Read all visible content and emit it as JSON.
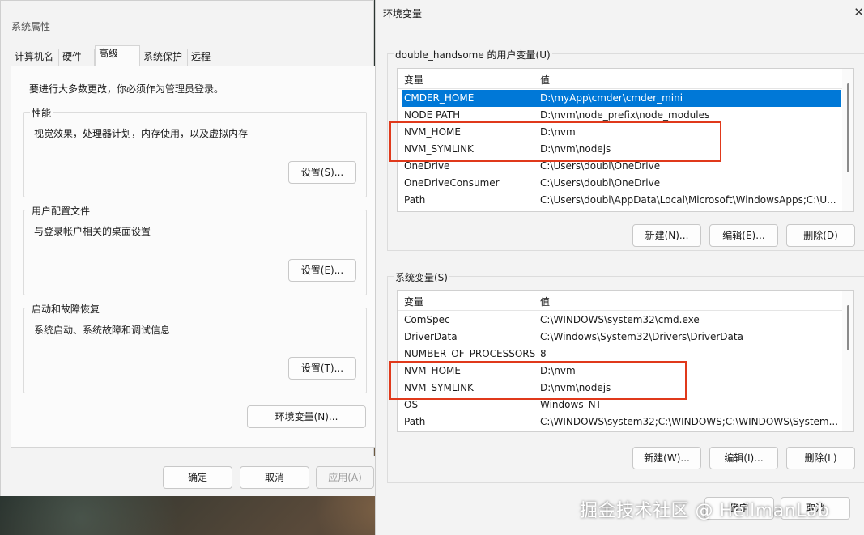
{
  "system_properties": {
    "title": "系统属性",
    "tabs": [
      "计算机名",
      "硬件",
      "高级",
      "系统保护",
      "远程"
    ],
    "admin_note": "要进行大多数更改，你必须作为管理员登录。",
    "performance": {
      "legend": "性能",
      "description": "视觉效果，处理器计划，内存使用，以及虚拟内存",
      "button": "设置(S)..."
    },
    "user_profiles": {
      "legend": "用户配置文件",
      "description": "与登录帐户相关的桌面设置",
      "button": "设置(E)..."
    },
    "startup_recovery": {
      "legend": "启动和故障恢复",
      "description": "系统启动、系统故障和调试信息",
      "button": "设置(T)..."
    },
    "env_button": "环境变量(N)...",
    "ok": "确定",
    "cancel": "取消",
    "apply": "应用(A)"
  },
  "env_vars": {
    "title": "环境变量",
    "close_glyph": "✕",
    "user_section": {
      "label": "double_handsome 的用户变量(U)",
      "col_var": "变量",
      "col_val": "值",
      "rows": [
        {
          "name": "CMDER_HOME",
          "value": "D:\\myApp\\cmder\\cmder_mini",
          "selected": true
        },
        {
          "name": "NODE PATH",
          "value": "D:\\nvm\\node_prefix\\node_modules",
          "selected": false
        },
        {
          "name": "NVM_HOME",
          "value": "D:\\nvm",
          "selected": false
        },
        {
          "name": "NVM_SYMLINK",
          "value": "D:\\nvm\\nodejs",
          "selected": false
        },
        {
          "name": "OneDrive",
          "value": "C:\\Users\\doubl\\OneDrive",
          "selected": false
        },
        {
          "name": "OneDriveConsumer",
          "value": "C:\\Users\\doubl\\OneDrive",
          "selected": false
        },
        {
          "name": "Path",
          "value": "C:\\Users\\doubl\\AppData\\Local\\Microsoft\\WindowsApps;C:\\U...",
          "selected": false
        }
      ],
      "new": "新建(N)...",
      "edit": "编辑(E)...",
      "delete": "删除(D)"
    },
    "system_section": {
      "label": "系统变量(S)",
      "col_var": "变量",
      "col_val": "值",
      "rows": [
        {
          "name": "ComSpec",
          "value": "C:\\WINDOWS\\system32\\cmd.exe",
          "selected": false
        },
        {
          "name": "DriverData",
          "value": "C:\\Windows\\System32\\Drivers\\DriverData",
          "selected": false
        },
        {
          "name": "NUMBER_OF_PROCESSORS",
          "value": "8",
          "selected": false
        },
        {
          "name": "NVM_HOME",
          "value": "D:\\nvm",
          "selected": false
        },
        {
          "name": "NVM_SYMLINK",
          "value": "D:\\nvm\\nodejs",
          "selected": false
        },
        {
          "name": "OS",
          "value": "Windows_NT",
          "selected": false
        },
        {
          "name": "Path",
          "value": "C:\\WINDOWS\\system32;C:\\WINDOWS;C:\\WINDOWS\\System...",
          "selected": false
        }
      ],
      "new": "新建(W)...",
      "edit": "编辑(I)...",
      "delete": "删除(L)"
    },
    "ok": "确定",
    "cancel": "取消"
  },
  "watermark": "掘金技术社区 @ HellmanLab",
  "colors": {
    "selection": "#0078d7",
    "highlight_box": "#e0391b"
  }
}
